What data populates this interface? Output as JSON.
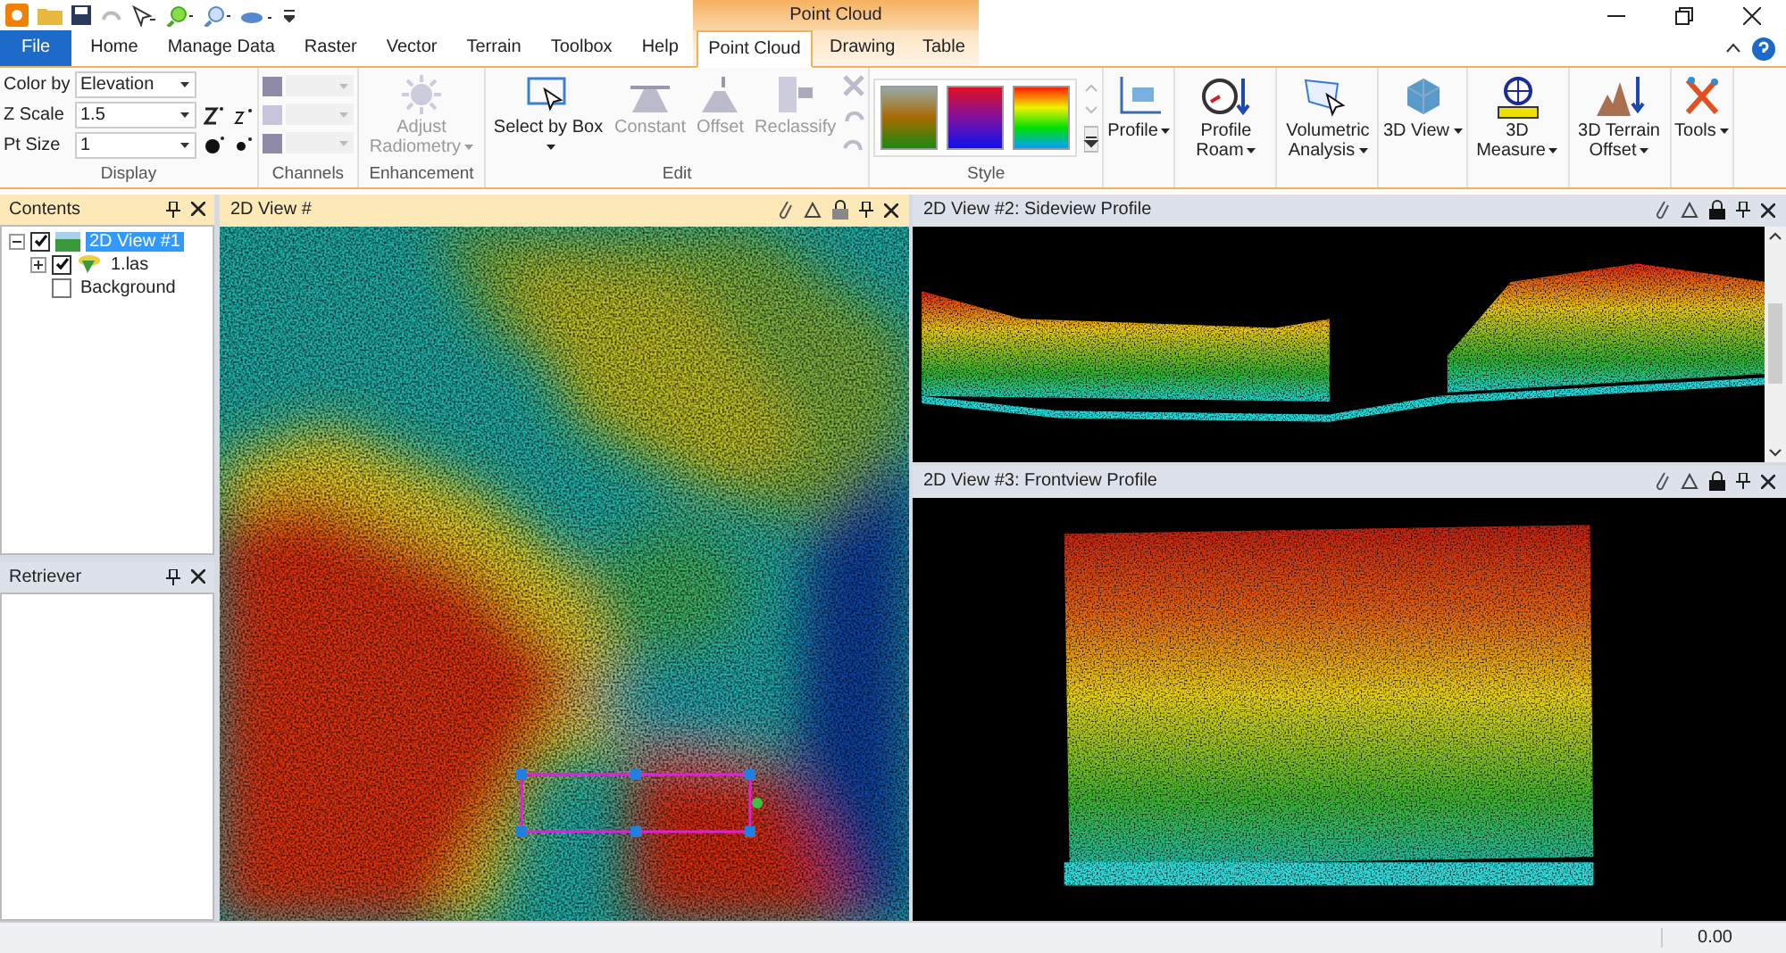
{
  "contextual_group": {
    "label": "Point Cloud"
  },
  "tabs": [
    {
      "label": "File",
      "kind": "file",
      "selected": false
    },
    {
      "label": "Home",
      "kind": "tab",
      "selected": false
    },
    {
      "label": "Manage Data",
      "kind": "tab",
      "selected": false
    },
    {
      "label": "Raster",
      "kind": "tab",
      "selected": false
    },
    {
      "label": "Vector",
      "kind": "tab",
      "selected": false
    },
    {
      "label": "Terrain",
      "kind": "tab",
      "selected": false
    },
    {
      "label": "Toolbox",
      "kind": "tab",
      "selected": false
    },
    {
      "label": "Help",
      "kind": "tab",
      "selected": false
    },
    {
      "label": "Point Cloud",
      "kind": "contextual",
      "selected": true
    },
    {
      "label": "Drawing",
      "kind": "contextual",
      "selected": false
    },
    {
      "label": "Table",
      "kind": "contextual",
      "selected": false
    }
  ],
  "ribbon": {
    "display": {
      "label": "Display",
      "fields": [
        {
          "label": "Color by",
          "value": "Elevation"
        },
        {
          "label": "Z Scale",
          "value": "1.5"
        },
        {
          "label": "Pt Size",
          "value": "1"
        }
      ]
    },
    "channels": {
      "label": "Channels"
    },
    "enhancement": {
      "label": "Enhancement",
      "buttons": [
        {
          "label": "Adjust Radiometry",
          "disabled": true,
          "dropdown": true
        }
      ]
    },
    "edit": {
      "label": "Edit",
      "buttons": [
        {
          "label": "Select by Box",
          "disabled": false,
          "dropdown": true
        },
        {
          "label": "Constant",
          "disabled": true,
          "dropdown": false
        },
        {
          "label": "Offset",
          "disabled": true,
          "dropdown": false
        },
        {
          "label": "Reclassify",
          "disabled": true,
          "dropdown": false
        }
      ]
    },
    "style": {
      "label": "Style",
      "swatches": [
        {
          "kind": "earth",
          "selected": false
        },
        {
          "kind": "redblue",
          "selected": false
        },
        {
          "kind": "rainbow",
          "selected": false
        }
      ]
    },
    "tools": [
      {
        "label": "Profile",
        "dropdown": true
      },
      {
        "label": "Profile Roam",
        "dropdown": true
      },
      {
        "label": "Volumetric Analysis",
        "dropdown": true
      },
      {
        "label": "3D View",
        "dropdown": true
      },
      {
        "label": "3D Measure",
        "dropdown": true
      },
      {
        "label": "3D Terrain Offset",
        "dropdown": true
      },
      {
        "label": "Tools",
        "dropdown": true
      }
    ]
  },
  "contents": {
    "title": "Contents",
    "tree": [
      {
        "label": "2D View #1",
        "checked": true,
        "selected": true,
        "expanded": true,
        "children": [
          {
            "label": "1.las",
            "checked": true,
            "selected": false,
            "expanded": false
          },
          {
            "label": "Background",
            "checked": false,
            "selected": false
          }
        ]
      }
    ]
  },
  "retriever": {
    "title": "Retriever"
  },
  "views": [
    {
      "title": "2D View #",
      "kind": "map",
      "active": true
    },
    {
      "title": "2D View #2: Sideview Profile",
      "kind": "side",
      "active": false
    },
    {
      "title": "2D View #3: Frontview Profile",
      "kind": "front",
      "active": false
    }
  ],
  "status_bar": {
    "value": "0.00"
  }
}
